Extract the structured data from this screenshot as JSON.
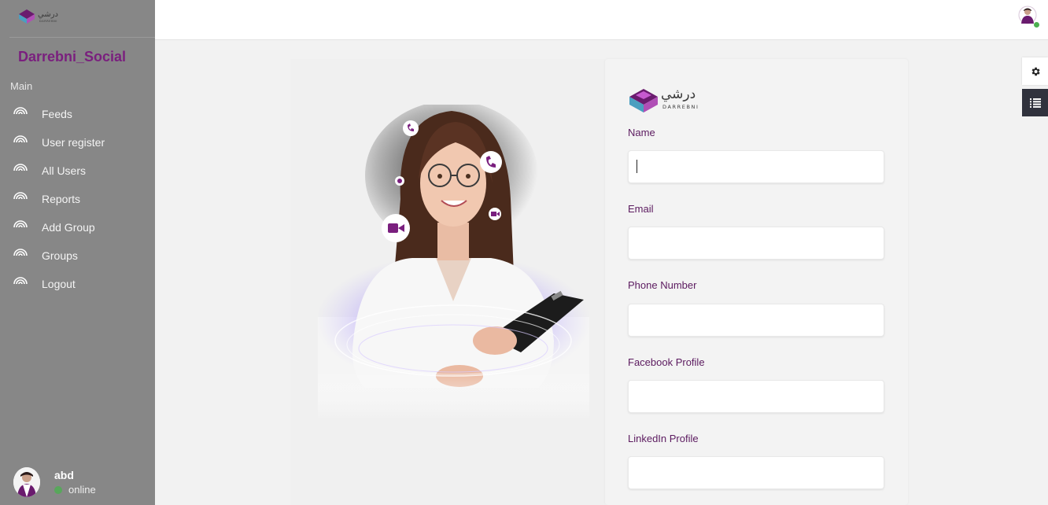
{
  "app": {
    "brand": "Darrebni_Social",
    "logo_text": "درشي",
    "logo_subtext": "DARREBNI"
  },
  "sidebar": {
    "section": "Main",
    "items": [
      {
        "label": "Feeds",
        "icon": "rainbow-icon"
      },
      {
        "label": "User register",
        "icon": "rainbow-icon"
      },
      {
        "label": "All Users",
        "icon": "rainbow-icon"
      },
      {
        "label": "Reports",
        "icon": "rainbow-icon"
      },
      {
        "label": "Add Group",
        "icon": "rainbow-icon"
      },
      {
        "label": "Groups",
        "icon": "rainbow-icon"
      },
      {
        "label": "Logout",
        "icon": "rainbow-icon"
      }
    ],
    "user": {
      "name": "abd",
      "status": "online"
    }
  },
  "form": {
    "fields": [
      {
        "label": "Name",
        "value": ""
      },
      {
        "label": "Email",
        "value": ""
      },
      {
        "label": "Phone Number",
        "value": ""
      },
      {
        "label": "Facebook Profile",
        "value": ""
      },
      {
        "label": "LinkedIn Profile",
        "value": ""
      }
    ]
  },
  "colors": {
    "brand_purple": "#7a1f7e",
    "sidebar_bg": "#878787",
    "online_green": "#4caf50",
    "dark_button": "#30323d"
  },
  "icons": {
    "settings": "gear-icon",
    "list": "list-icon"
  }
}
